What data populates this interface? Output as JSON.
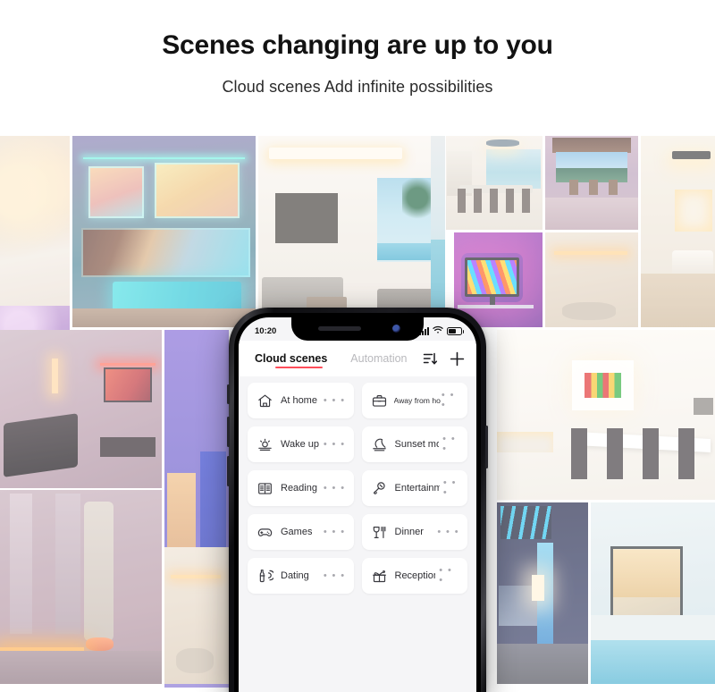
{
  "header": {
    "headline": "Scenes changing are up to you",
    "subheadline": "Cloud scenes  Add infinite possibilities"
  },
  "colors": {
    "accent_underline": "#ff4d5a",
    "active_tab_text": "#111111",
    "inactive_tab_text": "#b9b9bd",
    "screen_background": "#f5f5f7",
    "card_background": "#ffffff",
    "dots_color": "#a8a8ae",
    "headline_color": "#121212"
  },
  "phone": {
    "status_bar": {
      "time": "10:20",
      "signal_icon": "cellular-signal-icon",
      "wifi_icon": "wifi-icon",
      "battery_icon": "battery-icon",
      "battery_level_percent": 58
    },
    "app_bar": {
      "tabs": [
        {
          "label": "Cloud scenes",
          "active": true
        },
        {
          "label": "Automation",
          "active": false
        }
      ],
      "actions": [
        {
          "icon": "sort-filter-icon",
          "label": "Sort"
        },
        {
          "icon": "plus-icon",
          "label": "Add"
        }
      ]
    },
    "scenes": {
      "more_dots": "• • •",
      "rows": [
        [
          {
            "label": "At home",
            "icon": "home-icon",
            "tight": false
          },
          {
            "label": "Away from home",
            "icon": "briefcase-icon",
            "tight": true
          }
        ],
        [
          {
            "label": "Wake up",
            "icon": "sunrise-icon",
            "tight": false
          },
          {
            "label": "Sunset mode",
            "icon": "sunset-moon-icon",
            "tight": false
          }
        ],
        [
          {
            "label": "Reading",
            "icon": "book-icon",
            "tight": false
          },
          {
            "label": "Entertainment",
            "icon": "microphone-icon",
            "tight": false
          }
        ],
        [
          {
            "label": "Games",
            "icon": "gamepad-icon",
            "tight": false
          },
          {
            "label": "Dinner",
            "icon": "wineglass-fork-icon",
            "tight": false
          }
        ],
        [
          {
            "label": "Dating",
            "icon": "wine-bottle-glass-icon",
            "tight": false
          },
          {
            "label": "Reception",
            "icon": "gift-box-icon",
            "tight": false
          }
        ]
      ]
    }
  },
  "collage": {
    "tiles": [
      {
        "name": "tile-bedroom-warm",
        "description": "Warm-lit bedroom with bedside lamps"
      },
      {
        "name": "tile-villa-pool-rgb",
        "description": "Two-storey modern villa with cyan LED strips and lit pool"
      },
      {
        "name": "tile-purple-living-room",
        "description": "Living room washed in purple and magenta light"
      },
      {
        "name": "tile-open-living-pool",
        "description": "Bright open-plan living room looking onto a pool"
      },
      {
        "name": "tile-dining-sea-view",
        "description": "Dining table with pendant chandelier and sea view"
      },
      {
        "name": "tile-terrace-lake-view",
        "description": "Covered terrace with lounge chairs over a lake"
      },
      {
        "name": "tile-tv-rgb-backlight",
        "description": "Monitor with colourful RGB bias lighting on purple wall"
      },
      {
        "name": "tile-living-warm-art",
        "description": "Warm white living room with chandelier"
      },
      {
        "name": "tile-white-bedroom-track",
        "description": "White bedroom with black ceiling track lights"
      },
      {
        "name": "tile-pool-edge-sliver",
        "description": "Poolside edge with sun loungers"
      },
      {
        "name": "tile-lounge-pink-tv",
        "description": "Lounge chair facing a TV with pink ambient light"
      },
      {
        "name": "tile-hallway-led-strip",
        "description": "Bare feet in hallway lit by warm floor LED strip"
      },
      {
        "name": "tile-blue-purple-column",
        "description": "Narrow room bathed in blue and purple light"
      },
      {
        "name": "tile-warm-lounge-small",
        "description": "Small warm-lit lounge with coffee table"
      },
      {
        "name": "tile-white-dining-art",
        "description": "Bright white dining room with colourful wall art"
      },
      {
        "name": "tile-blue-bedroom-city",
        "description": "Blue-lit bedroom with city skyline view"
      },
      {
        "name": "tile-glass-house-pool",
        "description": "Glass-walled modern house beside an indoor pool"
      }
    ]
  }
}
